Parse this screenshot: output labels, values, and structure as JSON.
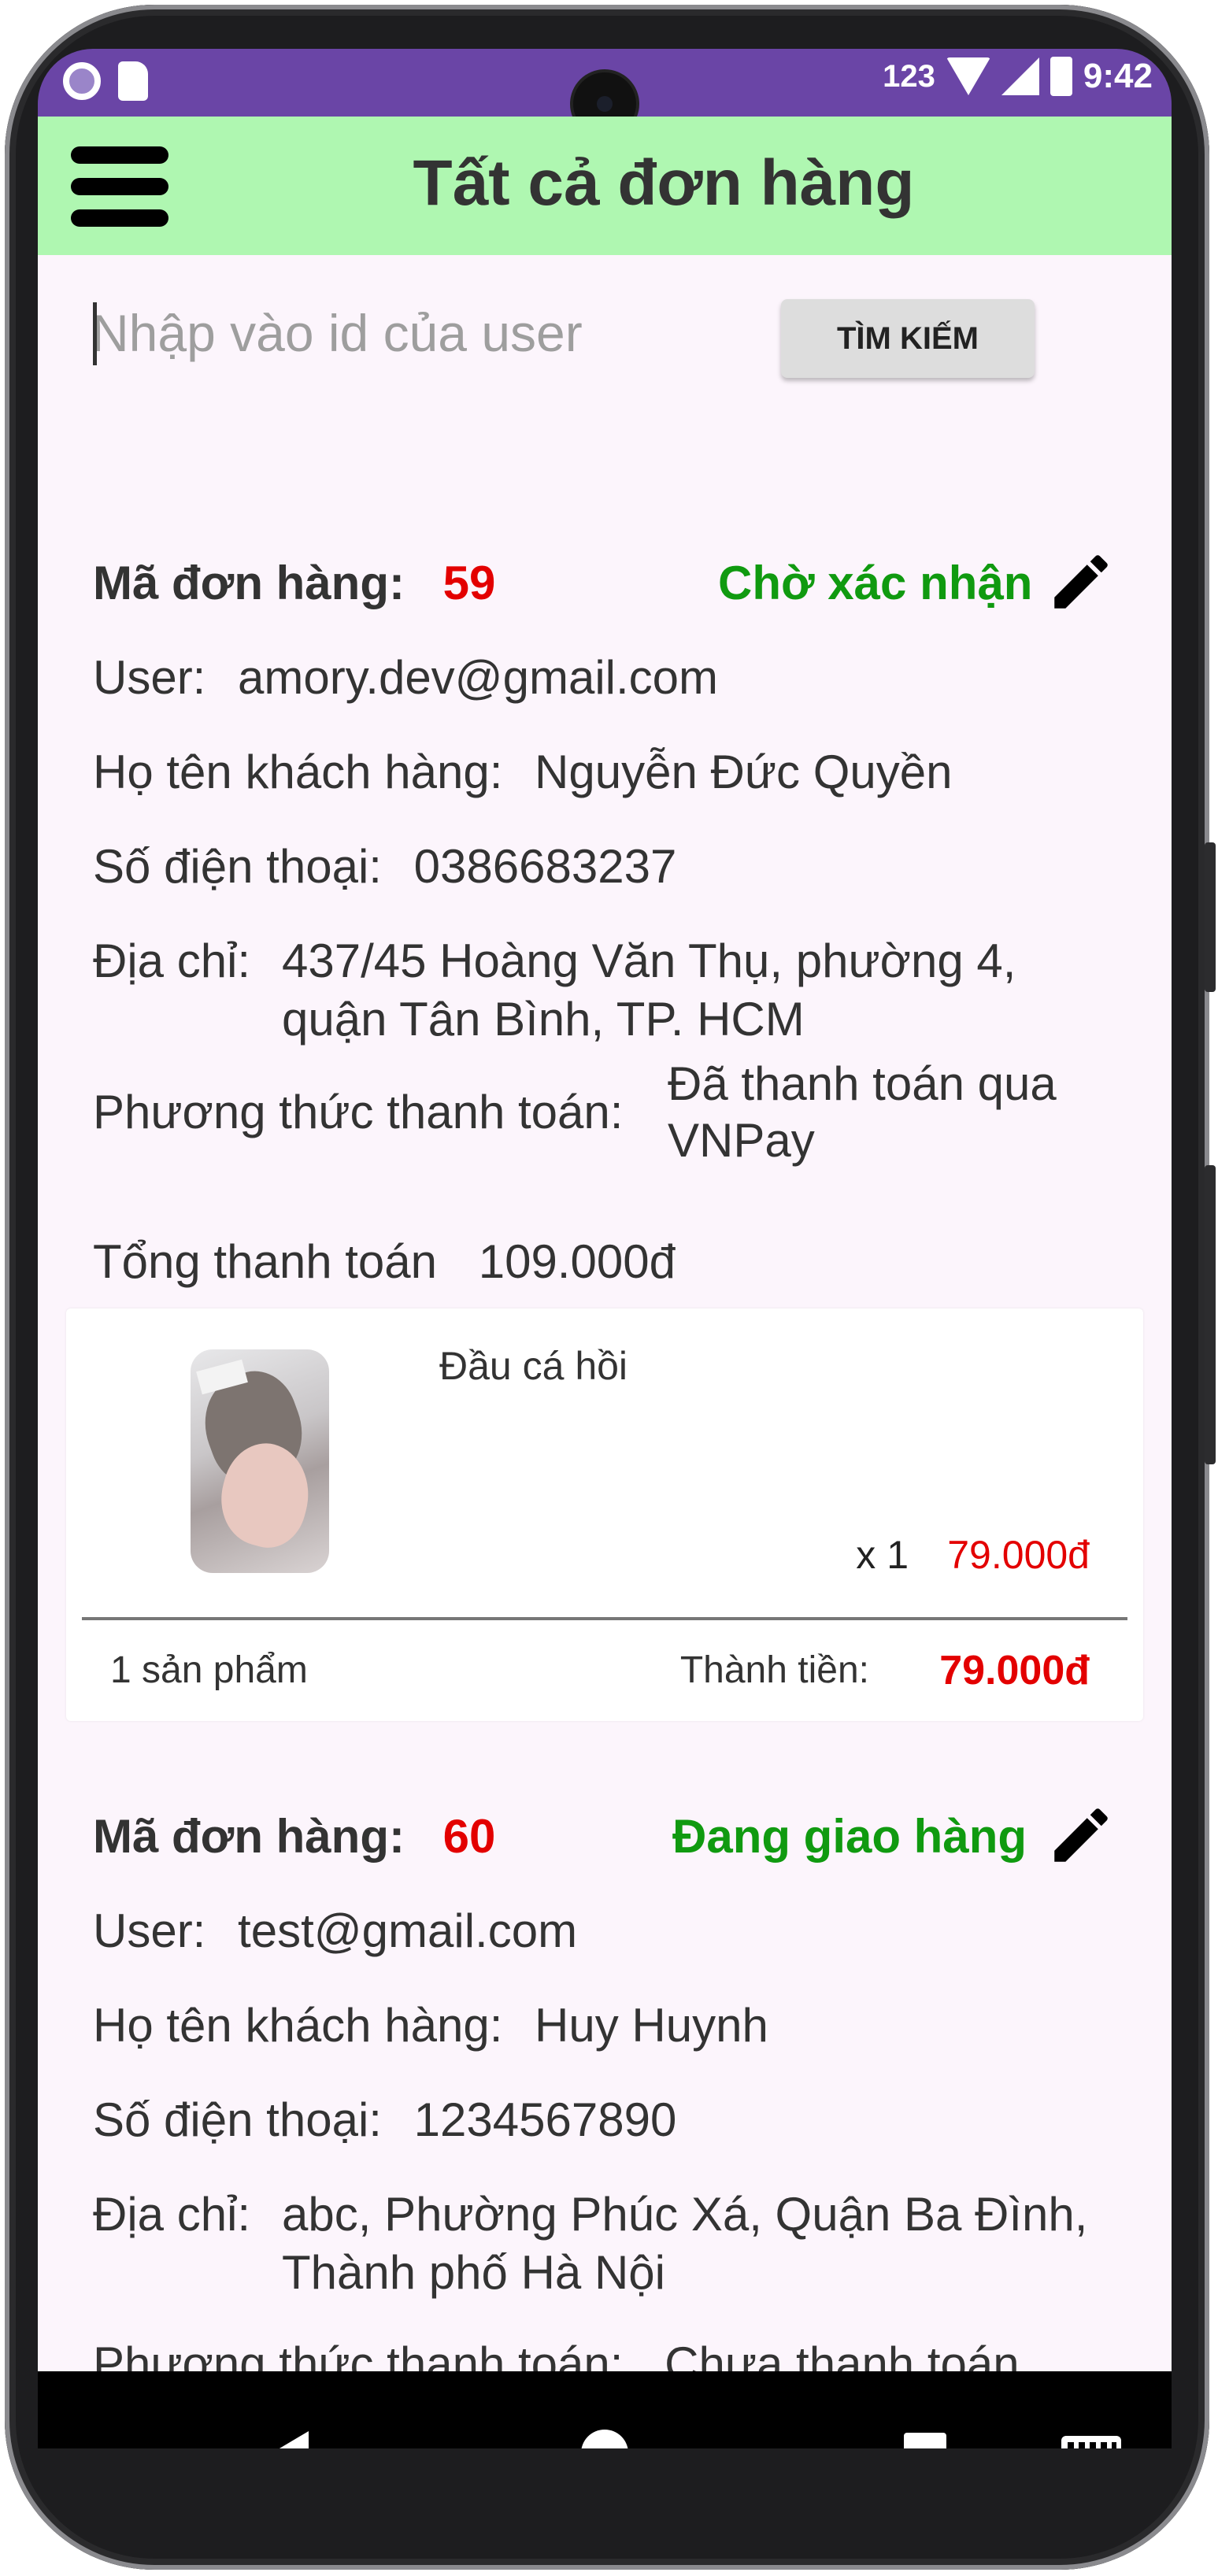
{
  "status_bar": {
    "time": "9:42",
    "network": "123"
  },
  "app_bar": {
    "title": "Tất cả đơn hàng"
  },
  "search": {
    "placeholder": "Nhập vào id của user",
    "button_label": "TÌM KIẾM"
  },
  "labels": {
    "order_id": "Mã đơn hàng:",
    "user": "User:",
    "customer_name": "Họ tên khách hàng:",
    "phone": "Số điện thoại:",
    "address": "Địa chỉ:",
    "payment_method": "Phương thức thanh toán:",
    "total_payment": "Tổng thanh toán",
    "product_count_suffix": "sản phẩm",
    "subtotal": "Thành tiền:"
  },
  "orders": [
    {
      "id": "59",
      "status": "Chờ xác nhận",
      "user": "amory.dev@gmail.com",
      "customer_name": "Nguyễn Đức Quyền",
      "phone": "0386683237",
      "address_line1": "437/45 Hoàng Văn Thụ, phường 4,",
      "address_line2": "quận Tân Bình, TP. HCM",
      "payment_line1": "Đã thanh toán qua",
      "payment_line2": "VNPay",
      "total": "109.000đ",
      "items": [
        {
          "name": "Đầu cá hồi",
          "quantity": "x 1",
          "price": "79.000đ",
          "image": "salmon-head-product-image"
        }
      ],
      "item_count": "1 sản phẩm",
      "subtotal": "79.000đ"
    },
    {
      "id": "60",
      "status": "Đang giao hàng",
      "user": "test@gmail.com",
      "customer_name": "Huy Huynh",
      "phone": "1234567890",
      "address_line1": "abc, Phường Phúc Xá, Quận Ba Đình,",
      "address_line2": "Thành phố Hà Nội",
      "payment": "Chưa thanh toán"
    }
  ],
  "colors": {
    "status_bar": "#6a45a6",
    "app_bar": "#aff7b1",
    "accent_red": "#e30000",
    "status_green": "#109a10",
    "background": "#fcf5fc"
  },
  "icons": {
    "menu": "hamburger-menu-icon",
    "edit": "pencil-icon",
    "back": "back-triangle-icon",
    "home": "home-circle-icon",
    "recents": "recents-square-icon",
    "keyboard": "keyboard-icon"
  }
}
